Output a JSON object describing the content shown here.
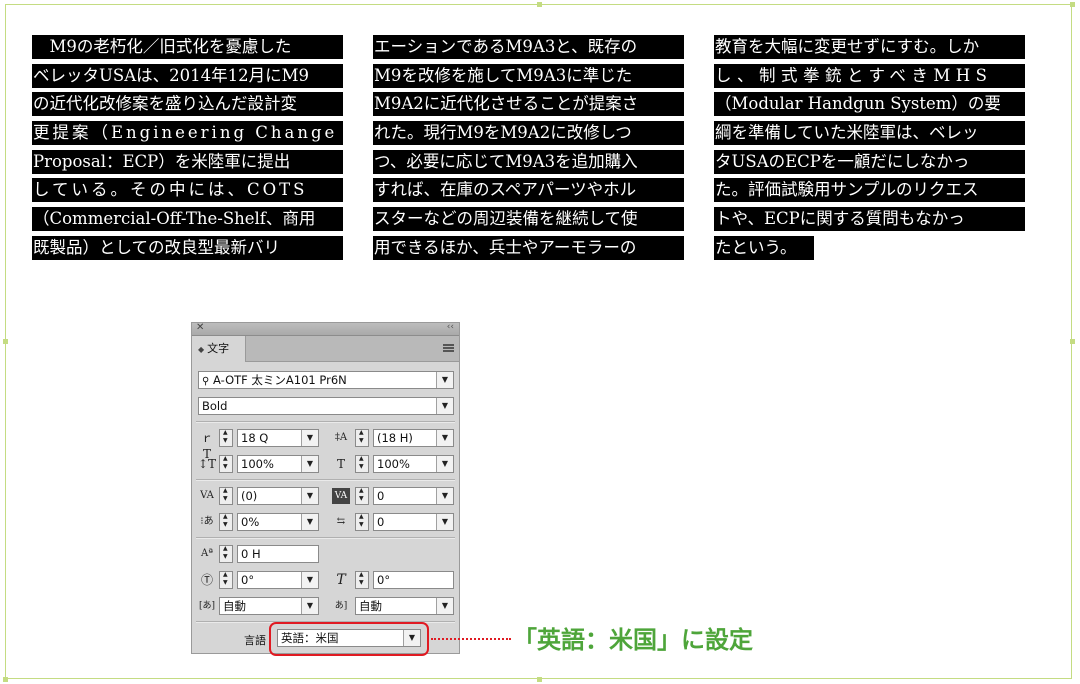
{
  "article": {
    "col1": [
      "　M9の老朽化／旧式化を憂慮した",
      "ベレッタUSAは、2014年12月にM9",
      "の近代化改修案を盛り込んだ設計変",
      "更提案（Engineering Change",
      "Proposal：ECP）を米陸軍に提出",
      "している。その中には、COTS",
      "（Commercial-Off-The-Shelf、商用",
      "既製品）としての改良型最新バリ"
    ],
    "col2": [
      "エーションであるM9A3と、既存の",
      "M9を改修を施してM9A3に準じた",
      "M9A2に近代化させることが提案さ",
      "れた。現行M9をM9A2に改修しつ",
      "つ、必要に応じてM9A3を追加購入",
      "すれば、在庫のスペアパーツやホル",
      "スターなどの周辺装備を継続して使",
      "用できるほか、兵士やアーモラーの"
    ],
    "col3": [
      "教育を大幅に変更せずにすむ。しか",
      "し、制式拳銃とすべきMHS",
      "（Modular Handgun System）の要",
      "綱を準備していた米陸軍は、ベレッ",
      "タUSAのECPを一顧だにしなかっ",
      "た。評価試験用サンプルのリクエス",
      "トや、ECPに関する質問もなかっ",
      "たという。"
    ]
  },
  "panel": {
    "close_glyph": "✕",
    "collapse_glyph": "‹‹",
    "tab_label": "文字",
    "font_family": "A-OTF 太ミンA101 Pr6N",
    "font_style": "Bold",
    "font_size": "18 Q",
    "leading": "(18 H)",
    "vertical_scale": "100%",
    "horizontal_scale": "100%",
    "kerning": "(0)",
    "tracking": "0",
    "tsume": "0%",
    "aki": "0",
    "baseline_shift": "0 H",
    "rotation": "0°",
    "skew": "0°",
    "mojikumi_before": "自動",
    "mojikumi_after": "自動",
    "language_label": "言語",
    "language_value": "英語：米国"
  },
  "callout": {
    "text": "「英語：米国」に設定",
    "color": "#4ea53a",
    "highlight_color": "#e01a22"
  }
}
